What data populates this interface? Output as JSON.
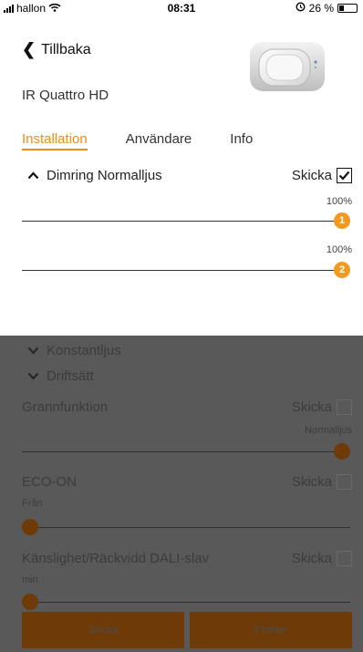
{
  "status_bar": {
    "carrier": "hallon",
    "time": "08:31",
    "battery": "26 %"
  },
  "header": {
    "back_label": "Tillbaka",
    "device_name": "IR Quattro HD"
  },
  "tabs": [
    {
      "label": "Installation",
      "active": true
    },
    {
      "label": "Användare",
      "active": false
    },
    {
      "label": "Info",
      "active": false
    }
  ],
  "dimming": {
    "section_label": "Dimring Normalljus",
    "send_label": "Skicka",
    "send_checked": true,
    "sliders": [
      {
        "number": "1",
        "value_label": "100%",
        "value": 1.0
      },
      {
        "number": "2",
        "value_label": "100%",
        "value": 1.0
      }
    ]
  },
  "sections": {
    "constant_light": "Konstantljus",
    "operating_mode": "Driftsätt"
  },
  "grannfunktion": {
    "label": "Grannfunktion",
    "send_label": "Skicka",
    "value_label": "Normalljus",
    "value": 1.0
  },
  "eco_on": {
    "label": "ECO-ON",
    "send_label": "Skicka",
    "value_label": "Från",
    "value": 0.0
  },
  "sensitivity": {
    "label": "Känslighet/Räckvidd DALI-slav",
    "send_label": "Skicka",
    "value_label": "min",
    "value": 0.0
  },
  "footer": {
    "send_button": "Skicka",
    "profiles_button": "Profiler"
  },
  "colors": {
    "accent": "#f08c16",
    "overlay": "#595959"
  }
}
